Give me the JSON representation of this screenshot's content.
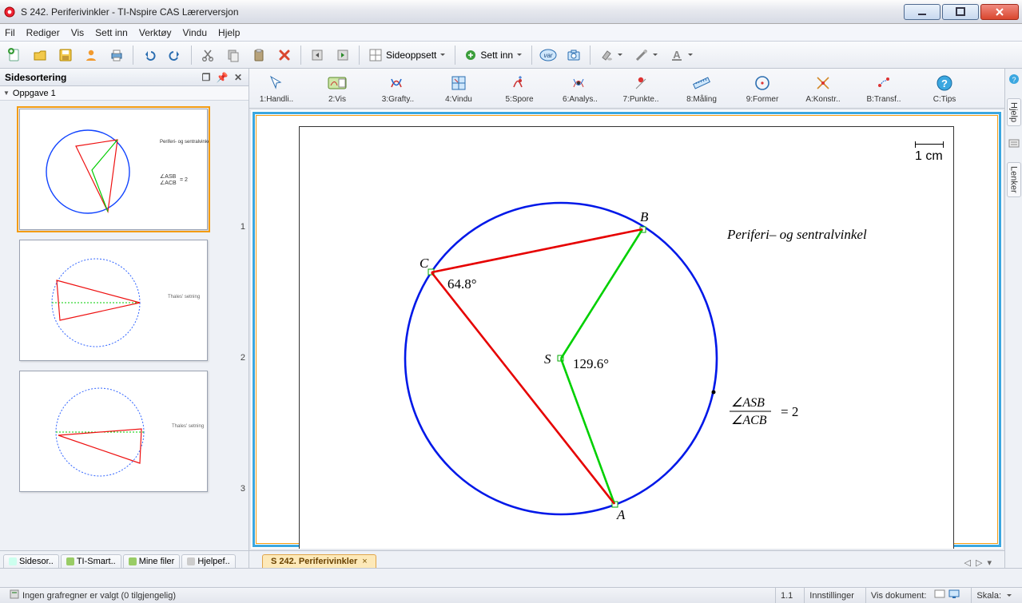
{
  "window": {
    "title": "S 242. Periferivinkler - TI-Nspire CAS  Lærerversjon"
  },
  "menu": {
    "file": "Fil",
    "edit": "Rediger",
    "view": "Vis",
    "insert": "Sett inn",
    "tools": "Verktøy",
    "window": "Vindu",
    "help": "Hjelp"
  },
  "toolbar": {
    "layout_label": "Sideoppsett",
    "insert_label": "Sett inn"
  },
  "sidepanel": {
    "title": "Sidesortering",
    "problem": "Oppgave 1",
    "thumb_nums": [
      "1",
      "2",
      "3"
    ],
    "tabs": {
      "pages": "Sidesor..",
      "tismart": "TI-Smart..",
      "myfiles": "Mine filer",
      "helpf": "Hjelpef.."
    }
  },
  "tooltabs": {
    "t1": "1:Handli..",
    "t2": "2:Vis",
    "t3": "3:Grafty..",
    "t4": "4:Vindu",
    "t5": "5:Spore",
    "t6": "6:Analys..",
    "t7": "7:Punkte..",
    "t8": "8:Måling",
    "t9": "9:Former",
    "tA": "A:Konstr..",
    "tB": "B:Transf..",
    "tC": "C:Tips"
  },
  "geometry": {
    "scale": "1 cm",
    "title_text": "Periferi– og sentralvinkel",
    "labelA": "A",
    "labelB": "B",
    "labelC": "C",
    "labelS": "S",
    "angleC": "64.8°",
    "angleS": "129.6°",
    "ratio_num": "∠ASB",
    "ratio_den": "∠ACB",
    "ratio_eq": "=  2"
  },
  "doctab": {
    "name": "S 242. Periferivinkler"
  },
  "rightstrip": {
    "help": "Hjelp",
    "links": "Lenker"
  },
  "status": {
    "left": "Ingen grafregner er valgt  (0 tilgjengelig)",
    "page": "1.1",
    "settings": "Innstillinger",
    "showdoc": "Vis dokument:",
    "scale": "Skala:"
  }
}
